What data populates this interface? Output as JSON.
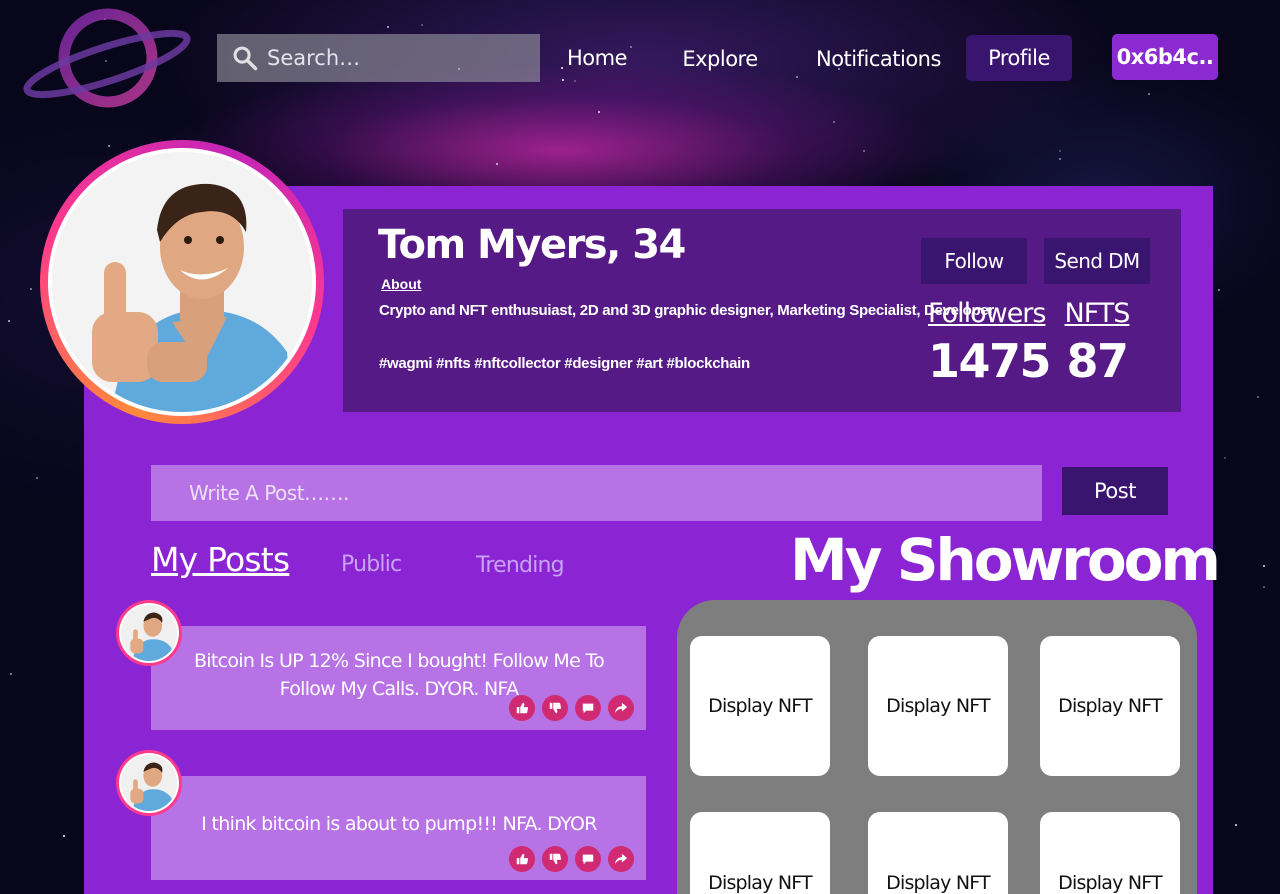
{
  "header": {
    "search_placeholder": "Search…",
    "nav": [
      "Home",
      "Explore",
      "Notifications"
    ],
    "profile_label": "Profile",
    "wallet_label": "0x6b4c.."
  },
  "profile": {
    "name": "Tom Myers, 34",
    "about_label": "About",
    "bio": "Crypto and NFT enthusuiast, 2D and 3D graphic designer, Marketing Specialist, Developer",
    "tags": "#wagmi #nfts #nftcollector #designer #art #blockchain",
    "follow_label": "Follow",
    "dm_label": "Send DM",
    "followers_label": "Followers",
    "followers_count": "1475",
    "nfts_label": "NFTS",
    "nfts_count": "87"
  },
  "composer": {
    "placeholder": "Write A Post…….",
    "post_label": "Post"
  },
  "tabs": [
    "My Posts",
    "Public",
    "Trending"
  ],
  "posts": [
    {
      "text": "Bitcoin Is UP 12% Since I bought! Follow Me To Follow My Calls. DYOR. NFA"
    },
    {
      "text": "I think bitcoin is about to pump!!! NFA. DYOR"
    }
  ],
  "showroom": {
    "title": "My Showroom",
    "items": [
      "Display NFT",
      "Display NFT",
      "Display NFT",
      "Display NFT",
      "Display NFT",
      "Display NFT"
    ]
  },
  "colors": {
    "panel": "#8b25d4",
    "info_box": "#561a86",
    "button_dark": "#3a1570",
    "accent_purple": "#8a2ad0",
    "post_card": "#b772e6",
    "action_icon": "#d02a72"
  },
  "icons": [
    "search-icon",
    "logo-planet-icon",
    "like-icon",
    "dislike-icon",
    "comment-icon",
    "share-icon"
  ]
}
